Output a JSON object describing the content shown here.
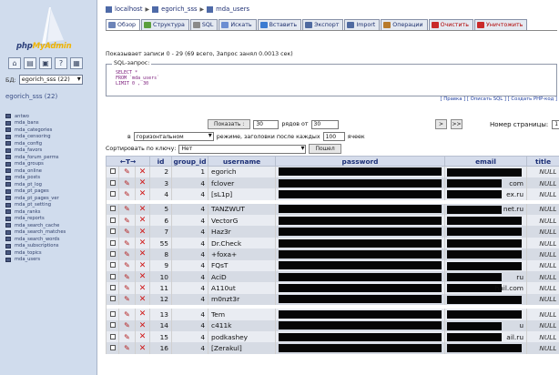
{
  "sidebar": {
    "logo": {
      "part1": "php",
      "part2": "MyAdmin"
    },
    "db_label": "БД:",
    "db_select": "egorich_sss (22)",
    "db_title": "egorich_sss (22)",
    "tables": [
      "antwo",
      "mda_bans",
      "mda_categories",
      "mda_censoring",
      "mda_config",
      "mda_favors",
      "mda_forum_perms",
      "mda_groups",
      "mda_online",
      "mda_posts",
      "mda_pt_log",
      "mda_pt_pages",
      "mda_pt_pages_ver",
      "mda_pt_setting",
      "mda_ranks",
      "mda_reports",
      "mda_search_cache",
      "mda_search_matches",
      "mda_search_words",
      "mda_subscriptions",
      "mda_topics",
      "mda_users"
    ]
  },
  "breadcrumb": {
    "server": "localhost",
    "database": "egorich_sss",
    "table": "mda_users"
  },
  "tabs": [
    {
      "label": "Обзор",
      "icon_color": "#6d84b8",
      "active": true
    },
    {
      "label": "Структура",
      "icon_color": "#5b9e3c"
    },
    {
      "label": "SQL",
      "icon_color": "#8a8a8a"
    },
    {
      "label": "Искать",
      "icon_color": "#6c8ed2"
    },
    {
      "label": "Вставить",
      "icon_color": "#3b7bd1"
    },
    {
      "label": "Экспорт",
      "icon_color": "#4f6aa0"
    },
    {
      "label": "Import",
      "icon_color": "#4f6aa0"
    },
    {
      "label": "Операции",
      "icon_color": "#b87a2b"
    },
    {
      "label": "Очистить",
      "icon_color": "#c92a2a",
      "danger": true
    },
    {
      "label": "Уничтожить",
      "icon_color": "#c92a2a",
      "danger": true
    }
  ],
  "info_text": "Показывает записи 0 - 29 (69 всего, Запрос занял 0.0013 сек)",
  "sql": {
    "legend": "SQL-запрос:",
    "line1": "SELECT *",
    "line2": "FROM `mda_users`",
    "line3": "LIMIT 0 , 30"
  },
  "sql_links": "[ Правка ] [ Описать SQL ] [ Создать PHP-код ]",
  "nav": {
    "show_button": "Показать :",
    "rows_value": "30",
    "rows_from_label": "рядов от",
    "from_value": "30",
    "in_label": "в",
    "mode_value": "горизонтальном",
    "mode_label": "режиме, заголовки после каждых",
    "repeat_value": "100",
    "cells_label": "ячеек",
    "next": ">",
    "last": ">>",
    "page_label": "Номер страницы:",
    "page_value": "1"
  },
  "sort": {
    "label": "Сортировать по ключу:",
    "value": "Нет",
    "go_button": "Пошел"
  },
  "columns": {
    "arrows": "←T→",
    "id": "id",
    "group_id": "group_id",
    "username": "username",
    "password": "password",
    "email": "email",
    "title": "title"
  },
  "rows": [
    {
      "id": "2",
      "group_id": "1",
      "username": "egorich",
      "email_tail": "",
      "title": "NULL"
    },
    {
      "id": "3",
      "group_id": "4",
      "username": "fclover",
      "email_tail": "com",
      "title": "NULL"
    },
    {
      "id": "4",
      "group_id": "4",
      "username": "[sL1p]",
      "email_tail": "ex.ru",
      "title": "NULL"
    },
    {
      "gap": true
    },
    {
      "id": "5",
      "group_id": "4",
      "username": "TANZWUT",
      "email_tail": "net.ru",
      "title": "NULL"
    },
    {
      "id": "6",
      "group_id": "4",
      "username": "VectorG",
      "email_tail": "",
      "title": "NULL"
    },
    {
      "id": "7",
      "group_id": "4",
      "username": "Haz3r",
      "email_tail": "",
      "title": "NULL"
    },
    {
      "id": "55",
      "group_id": "4",
      "username": "Dr.Check",
      "email_tail": "",
      "title": "NULL"
    },
    {
      "id": "8",
      "group_id": "4",
      "username": "+foxa+",
      "email_tail": "",
      "title": "NULL"
    },
    {
      "id": "9",
      "group_id": "4",
      "username": "FQsT",
      "email_tail": "",
      "title": "NULL"
    },
    {
      "id": "10",
      "group_id": "4",
      "username": "AciD",
      "email_tail": "ru",
      "title": "NULL"
    },
    {
      "id": "11",
      "group_id": "4",
      "username": "A110ut",
      "email_tail": "hail.com",
      "title": "NULL"
    },
    {
      "id": "12",
      "group_id": "4",
      "username": "m0nzt3r",
      "email_tail": "",
      "title": "NULL"
    },
    {
      "gap": true
    },
    {
      "id": "13",
      "group_id": "4",
      "username": "Tem",
      "email_tail": "",
      "title": "NULL"
    },
    {
      "id": "14",
      "group_id": "4",
      "username": "c411k",
      "email_tail": "u",
      "title": "NULL"
    },
    {
      "id": "15",
      "group_id": "4",
      "username": "podkashey",
      "email_tail": "ail.ru",
      "title": "NULL"
    },
    {
      "id": "16",
      "group_id": "4",
      "username": "[Zerakul]",
      "email_tail": "",
      "title": "NULL"
    }
  ]
}
